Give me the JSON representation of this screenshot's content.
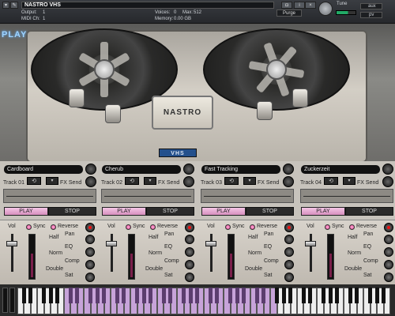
{
  "header": {
    "title": "NASTRO VHS",
    "output_label": "Output:",
    "output_value": "1",
    "midi_label": "MIDI Ch:",
    "midi_value": "1",
    "voices_label": "Voices:",
    "voices_value": "0",
    "max_label": "Max:",
    "max_value": "512",
    "memory_label": "Memory:",
    "memory_value": "0.00 GB",
    "purge_label": "Purge",
    "tune_label": "Tune",
    "tune_value": "0.00",
    "aux_label": "aux",
    "pv_label": "pv"
  },
  "machine": {
    "play_title": "PLAY",
    "head_label": "NASTRO",
    "badge": "VHS"
  },
  "tracks": [
    {
      "name": "Cardboard",
      "track_label": "Track 01",
      "fx_label": "FX Send",
      "play": "PLAY",
      "stop": "STOP",
      "loop_icon": "⟲",
      "dd_icon": "▾"
    },
    {
      "name": "Cherub",
      "track_label": "Track 02",
      "fx_label": "FX Send",
      "play": "PLAY",
      "stop": "STOP",
      "loop_icon": "⟲",
      "dd_icon": "▾"
    },
    {
      "name": "Fast Tracking",
      "track_label": "Track 03",
      "fx_label": "FX Send",
      "play": "PLAY",
      "stop": "STOP",
      "loop_icon": "⟲",
      "dd_icon": "▾"
    },
    {
      "name": "Zuckerzeit",
      "track_label": "Track 04",
      "fx_label": "FX Send",
      "play": "PLAY",
      "stop": "STOP",
      "loop_icon": "⟲",
      "dd_icon": "▾"
    }
  ],
  "strips": [
    {
      "vol": "Vol",
      "sync": "Sync",
      "reverse": "Reverse",
      "half": "Half",
      "norm": "Norm",
      "double": "Double",
      "pan": "Pan",
      "eq": "EQ",
      "comp": "Comp",
      "sat": "Sat"
    },
    {
      "vol": "Vol",
      "sync": "Sync",
      "reverse": "Reverse",
      "half": "Half",
      "norm": "Norm",
      "double": "Double",
      "pan": "Pan",
      "eq": "EQ",
      "comp": "Comp",
      "sat": "Sat"
    },
    {
      "vol": "Vol",
      "sync": "Sync",
      "reverse": "Reverse",
      "half": "Half",
      "norm": "Norm",
      "double": "Double",
      "pan": "Pan",
      "eq": "EQ",
      "comp": "Comp",
      "sat": "Sat"
    },
    {
      "vol": "Vol",
      "sync": "Sync",
      "reverse": "Reverse",
      "half": "Half",
      "norm": "Norm",
      "double": "Double",
      "pan": "Pan",
      "eq": "EQ",
      "comp": "Comp",
      "sat": "Sat"
    }
  ],
  "colors": {
    "accent_pink": "#d78fbe",
    "badge_blue": "#24508c",
    "play_title_blue": "#9fd4ff"
  }
}
